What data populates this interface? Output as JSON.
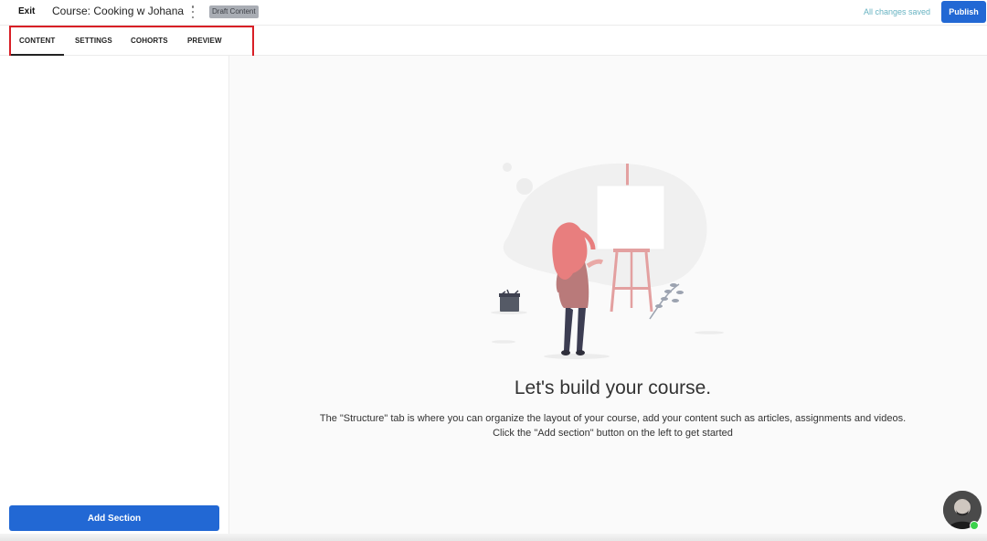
{
  "header": {
    "exit_label": "Exit",
    "course_title": "Course: Cooking w Johana",
    "draft_badge": "Draft Content",
    "save_status": "All changes saved",
    "publish_label": "Publish"
  },
  "tabs": [
    {
      "label": "CONTENT",
      "active": true
    },
    {
      "label": "SETTINGS",
      "active": false
    },
    {
      "label": "COHORTS",
      "active": false
    },
    {
      "label": "PREVIEW",
      "active": false
    }
  ],
  "sidebar": {
    "add_section_label": "Add Section"
  },
  "empty_state": {
    "heading": "Let's build your course.",
    "description_line1": "The \"Structure\" tab is where you can organize the layout of your course, add your content such as articles, assignments and videos.",
    "description_line2": "Click the \"Add section\" button on the left to get started"
  },
  "colors": {
    "primary": "#2268d4",
    "highlight": "#d81f26",
    "saved_text": "#67b3c2",
    "online_status": "#3bd24c"
  },
  "icons": {
    "menu": "kebab-menu-icon",
    "chat": "support-avatar"
  }
}
